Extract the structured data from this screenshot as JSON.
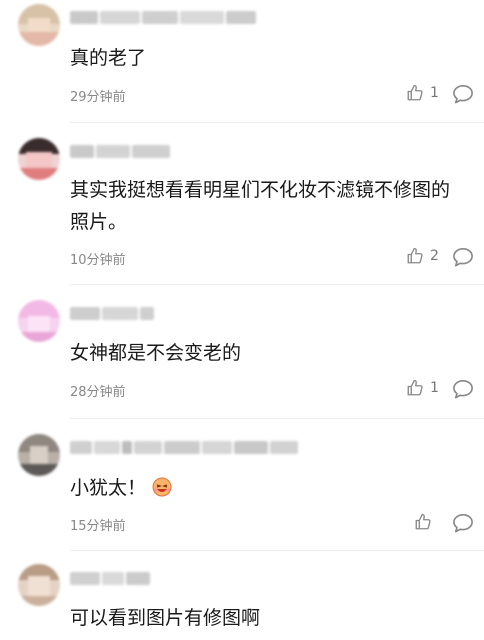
{
  "comments": [
    {
      "text": "真的老了",
      "time": "29分钟前",
      "likes": "1"
    },
    {
      "text": "其实我挺想看看明星们不化妆不滤镜不修图的照片。",
      "time": "10分钟前",
      "likes": "2"
    },
    {
      "text": "女神都是不会变老的",
      "time": "28分钟前",
      "likes": "1"
    },
    {
      "text": "小犹太！",
      "time": "15分钟前",
      "likes": ""
    },
    {
      "text": "可以看到图片有修图啊",
      "time": "",
      "likes": ""
    }
  ],
  "icons": {
    "like": "thumbs-up-icon",
    "reply": "reply-bubble-icon",
    "emoji": "laughing-emoji-icon"
  },
  "colors": {
    "text": "#1a1a1a",
    "meta": "#888888",
    "divider": "#ececec"
  }
}
